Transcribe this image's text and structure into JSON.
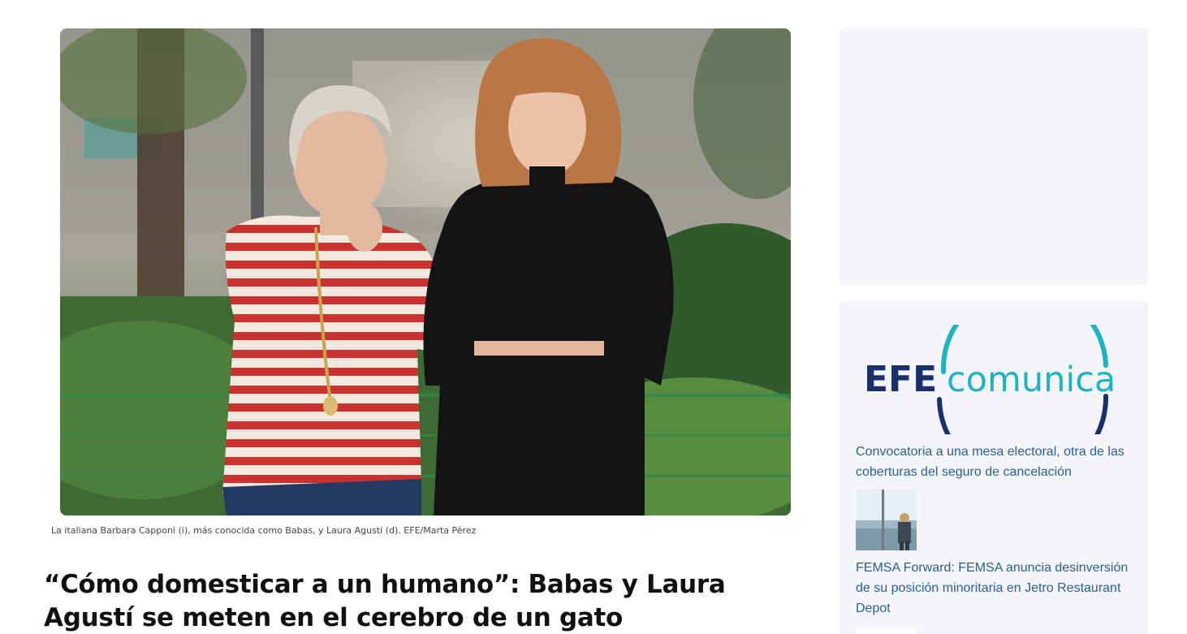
{
  "article": {
    "photo_alt": "Barbara Capponi y Laura Agustí",
    "caption": "La italiana Barbara Capponi (i), más conocida como Babas, y Laura Agustí (d). EFE/Marta Pérez",
    "headline": "“Cómo domesticar a un humano”: Babas y Laura Agustí se meten en el cerebro de un gato"
  },
  "sidebar": {
    "logo": {
      "part1": "EFE",
      "part2": "comunica",
      "color_dark": "#1b2f6b",
      "color_accent": "#1fb3c2"
    },
    "items": [
      {
        "title": "Convocatoria a una mesa electoral, otra de las coberturas del seguro de cancelación"
      },
      {
        "title": "FEMSA Forward: FEMSA anuncia desinversión de su posición minoritaria en Jetro Restaurant Depot"
      }
    ]
  },
  "colors": {
    "link": "#2c5f8f",
    "panel_bg": "#f3f5f8"
  }
}
